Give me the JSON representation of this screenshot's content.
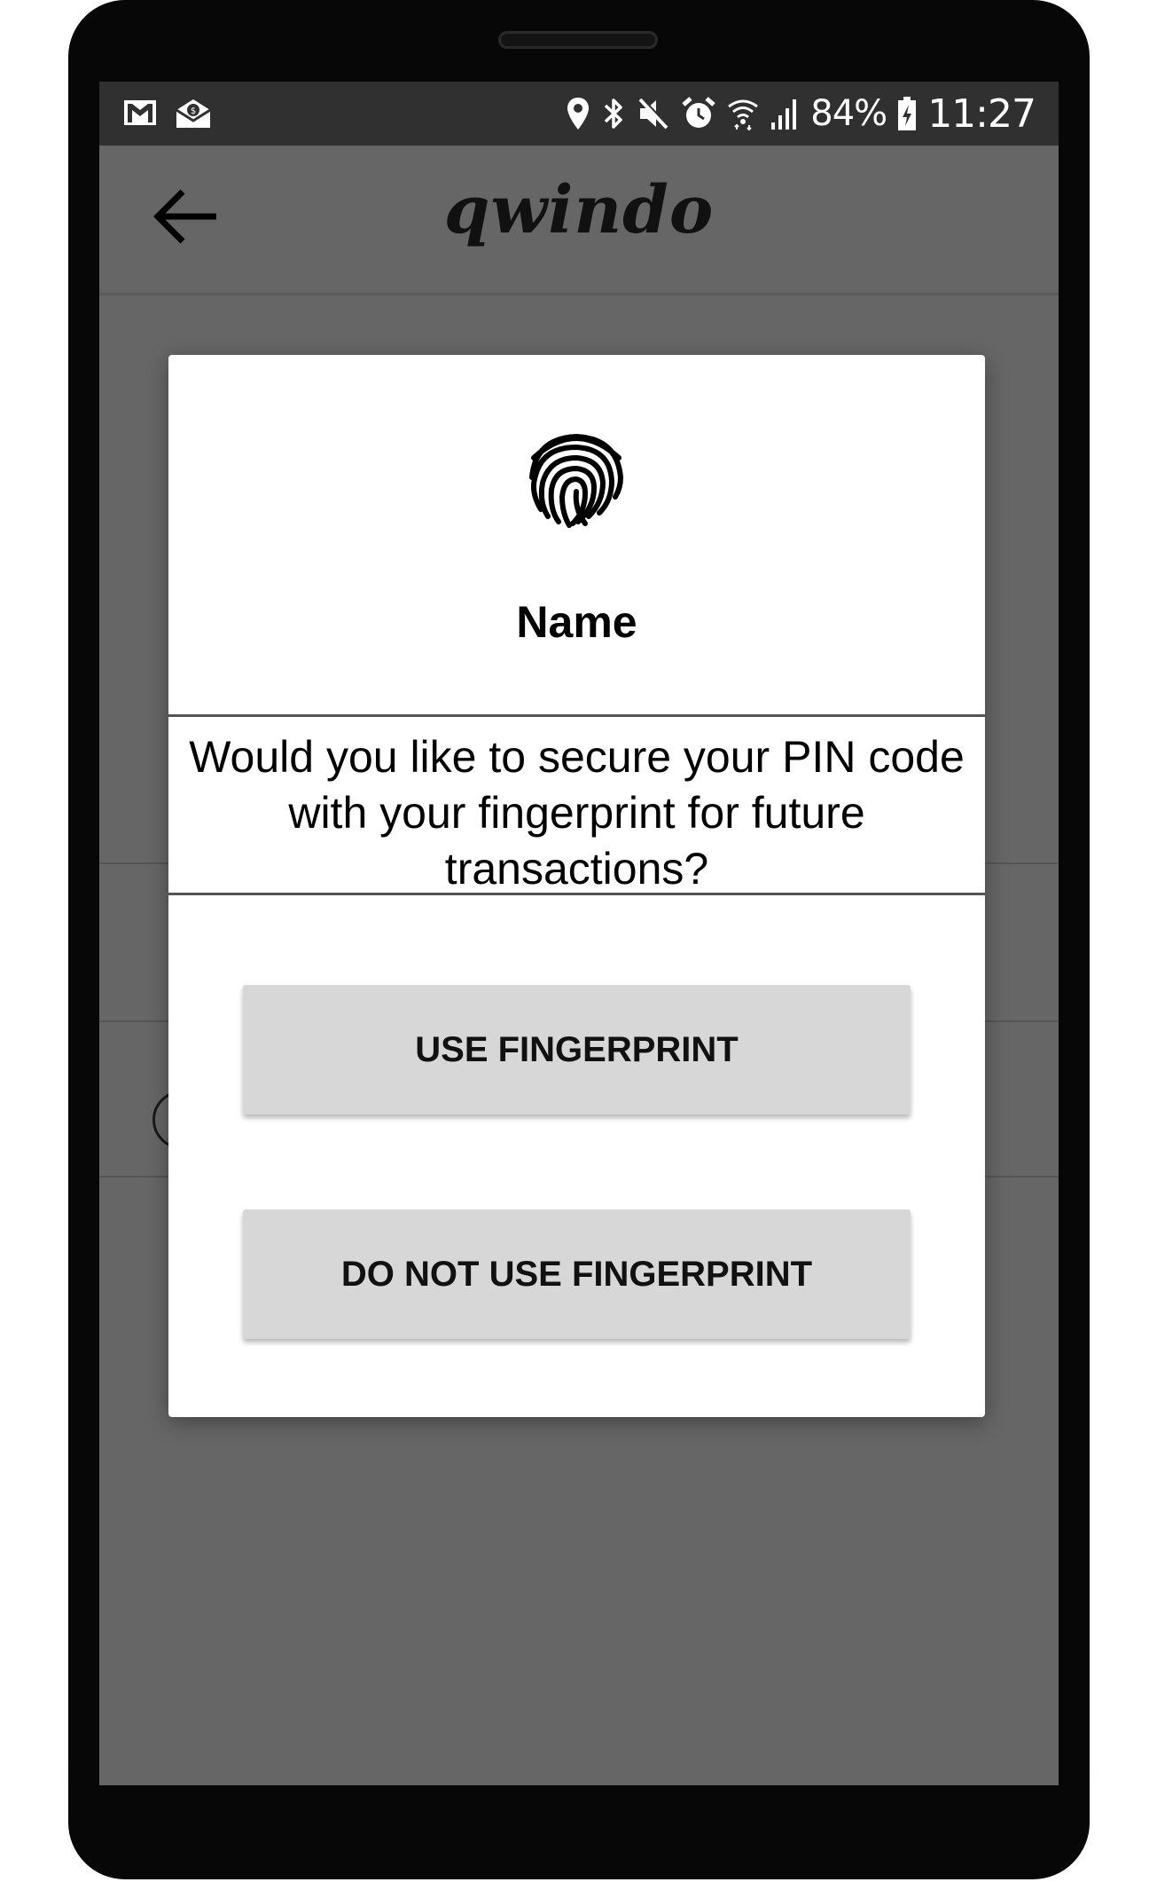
{
  "status_bar": {
    "left_icons": [
      "gmail-icon",
      "mail-notification-icon"
    ],
    "right_icons": [
      "location-icon",
      "bluetooth-icon",
      "mute-icon",
      "alarm-icon",
      "wifi-icon",
      "signal-icon",
      "battery-charging-icon"
    ],
    "battery": "84%",
    "time": "11:27"
  },
  "app_bar": {
    "back_icon": "arrow-left-icon",
    "brand": "qwindo"
  },
  "dialog": {
    "icon": "fingerprint-icon",
    "title": "Name",
    "message": "Would you like to secure your PIN code with your fingerprint for future transactions?",
    "primary_button": "USE FINGERPRINT",
    "secondary_button": "DO NOT USE FINGERPRINT"
  },
  "colors": {
    "screen_bg": "#666666",
    "status_bar_bg": "#303030",
    "dialog_bg": "#ffffff",
    "button_bg": "#d6d7d6"
  }
}
